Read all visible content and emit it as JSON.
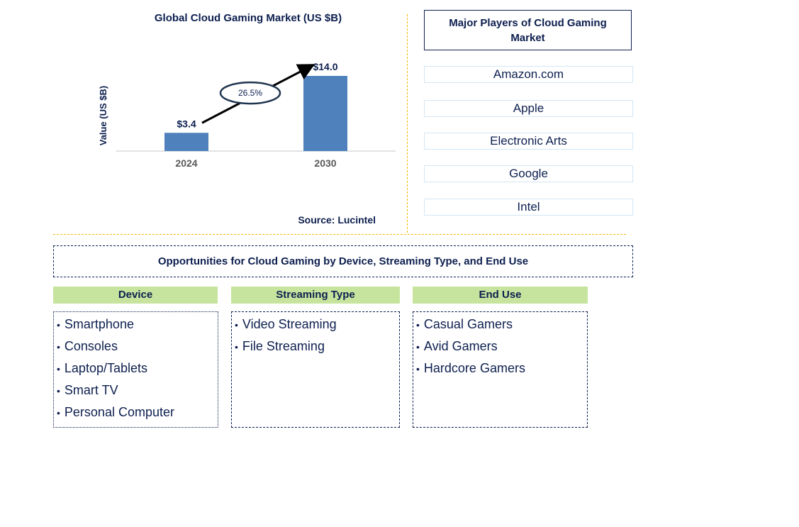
{
  "chart_data": {
    "type": "bar",
    "title": "Global Cloud Gaming Market (US $B)",
    "xlabel": "",
    "ylabel": "Value (US $B)",
    "categories": [
      "2024",
      "2030"
    ],
    "values": [
      3.4,
      14.0
    ],
    "data_labels": [
      "$3.4",
      "$14.0"
    ],
    "ylim": [
      0,
      14.0
    ],
    "grid": false,
    "bar_color": "#4f81bd",
    "annotation": {
      "type": "growth-arrow",
      "label": "26.5%",
      "from": "2024",
      "to": "2030"
    },
    "source": "Source: Lucintel"
  },
  "players": {
    "title": "Major Players of Cloud Gaming Market",
    "items": [
      "Amazon.com",
      "Apple",
      "Electronic Arts",
      "Google",
      "Intel"
    ]
  },
  "opportunities": {
    "title": "Opportunities for Cloud Gaming by Device, Streaming Type, and End Use",
    "categories": [
      {
        "header": "Device",
        "items": [
          "Smartphone",
          "Consoles",
          "Laptop/Tablets",
          "Smart TV",
          "Personal Computer"
        ]
      },
      {
        "header": "Streaming Type",
        "items": [
          "Video Streaming",
          "File Streaming"
        ]
      },
      {
        "header": "End Use",
        "items": [
          "Casual Gamers",
          "Avid Gamers",
          "Hardcore Gamers"
        ]
      }
    ]
  },
  "colors": {
    "text": "#0d1f4f",
    "bar": "#4f81bd",
    "header_fill": "#c6e49d",
    "divider": "#f5b800",
    "player_border": "#d4e6f4"
  }
}
